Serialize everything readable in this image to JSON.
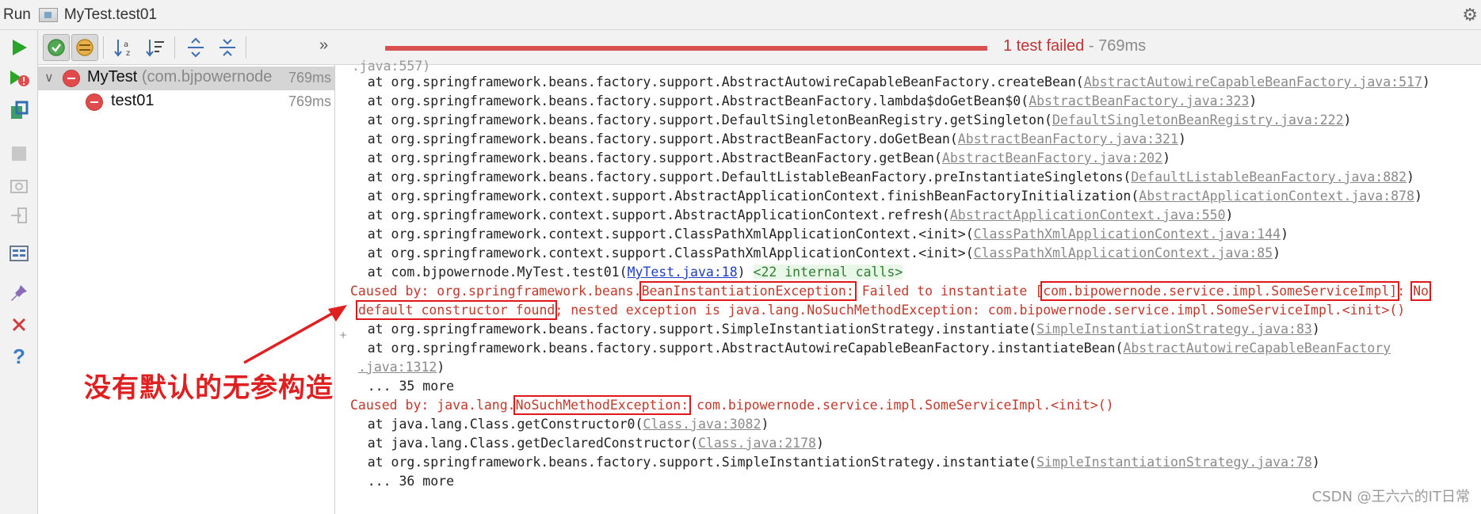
{
  "titlebar": {
    "run_label": "Run",
    "title": "MyTest.test01"
  },
  "status": {
    "failed_text": "1 test failed",
    "time_text": " - 769ms"
  },
  "tree": {
    "root": {
      "name": "MyTest",
      "package": " (com.bjpowernode",
      "time": "769ms"
    },
    "child": {
      "name": "test01",
      "time": "769ms"
    }
  },
  "console": {
    "lines": [
      "  .java:557)",
      "    at org.springframework.beans.factory.support.AbstractAutowireCapableBeanFactory.createBean(",
      "    at org.springframework.beans.factory.support.AbstractBeanFactory.lambda$doGetBean$0(",
      "    at org.springframework.beans.factory.support.DefaultSingletonBeanRegistry.getSingleton(",
      "    at org.springframework.beans.factory.support.AbstractBeanFactory.doGetBean(",
      "    at org.springframework.beans.factory.support.AbstractBeanFactory.getBean(",
      "    at org.springframework.beans.factory.support.DefaultListableBeanFactory.preInstantiateSingletons(",
      "    at org.springframework.context.support.AbstractApplicationContext.finishBeanFactoryInitialization(",
      "    at org.springframework.context.support.AbstractApplicationContext.refresh(",
      "    at org.springframework.context.support.ClassPathXmlApplicationContext.<init>(",
      "    at org.springframework.context.support.ClassPathXmlApplicationContext.<init>(",
      "    at com.bjpowernode.MyTest.test01("
    ],
    "links": [
      "",
      "AbstractAutowireCapableBeanFactory.java:517",
      "AbstractBeanFactory.java:323",
      "DefaultSingletonBeanRegistry.java:222",
      "AbstractBeanFactory.java:321",
      "AbstractBeanFactory.java:202",
      "DefaultListableBeanFactory.java:882",
      "AbstractApplicationContext.java:878",
      "AbstractApplicationContext.java:550",
      "ClassPathXmlApplicationContext.java:144",
      "ClassPathXmlApplicationContext.java:85",
      "MyTest.java:18"
    ],
    "internal_calls": "<22 internal calls>",
    "caused1_prefix": "Caused by: org.springframework.beans.",
    "caused1_exception": "BeanInstantiationException:",
    "caused1_mid": " Failed to instantiate [",
    "caused1_class": "com.bipowernode.service.impl.SomeServiceImpl]",
    "caused1_colon": ": ",
    "caused1_no": "No",
    "caused1_line2_boxed": "default constructor found",
    "caused1_line2_rest": "; nested exception is java.lang.NoSuchMethodException: com.bipowernode.service.impl.SomeServiceImpl.<init>()",
    "si_line": "    at org.springframework.beans.factory.support.SimpleInstantiationStrategy.instantiate(",
    "si_link": "SimpleInstantiationStrategy.java:83",
    "ib_line": "    at org.springframework.beans.factory.support.AbstractAutowireCapableBeanFactory.instantiateBean(",
    "ib_link": "AbstractAutowireCapableBeanFactory",
    "ib_link2": ".java:1312",
    "more35": "    ... 35 more",
    "caused2_prefix": "Caused by: java.lang.",
    "caused2_exception": "NoSuchMethodException:",
    "caused2_rest": " com.bipowernode.service.impl.SomeServiceImpl.<init>()",
    "c1_line": "    at java.lang.Class.getConstructor0(",
    "c1_link": "Class.java:3082",
    "c2_line": "    at java.lang.Class.getDeclaredConstructor(",
    "c2_link": "Class.java:2178",
    "si2_line": "    at org.springframework.beans.factory.support.SimpleInstantiationStrategy.instantiate(",
    "si2_link": "SimpleInstantiationStrategy.java:78",
    "more36": "    ... 36 more"
  },
  "annotation": "没有默认的无参构造",
  "watermark": "CSDN @王六六的IT日常",
  "colors": {
    "fail_red": "#c03434",
    "progress": "#d95050",
    "annotation": "#e02020",
    "run_green": "#2aa52a"
  }
}
